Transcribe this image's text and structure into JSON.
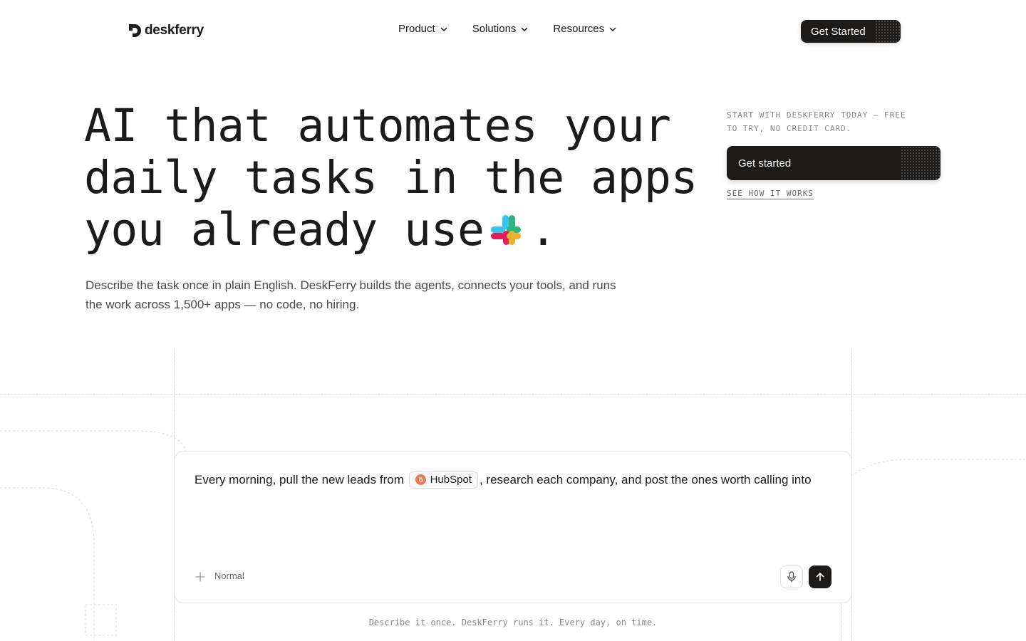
{
  "brand": {
    "name": "deskferry"
  },
  "nav": {
    "items": [
      {
        "label": "Product"
      },
      {
        "label": "Solutions"
      },
      {
        "label": "Resources"
      }
    ],
    "cta_label": "Get Started"
  },
  "hero": {
    "headline_part1": "AI that automates your",
    "headline_highlight": "daily tasks",
    "headline_part2": " in the apps",
    "headline_part3": "you already use",
    "headline_end": ".",
    "inline_icon": "slack-icon",
    "highlight_color": "#c2fa73",
    "subhead": "Describe the task once in plain English. DeskFerry builds the agents, connects your tools, and runs the work across 1,500+ apps — no code, no hiring."
  },
  "cta": {
    "note": "START WITH DESKFERRY TODAY — FREE TO TRY, NO CREDIT CARD.",
    "button_label": "Get started",
    "link_label": "SEE HOW IT WORKS"
  },
  "prompt": {
    "text_before": "Every morning, pull the new leads from",
    "chip_label": "HubSpot",
    "chip_icon": "hubspot-icon",
    "text_after": ", research each company, and post the ones worth calling into",
    "mode_label": "Normal",
    "footnote": "Describe it once. DeskFerry runs it. Every day, on time."
  },
  "colors": {
    "dark": "#1c1b1a",
    "hubspot": "#ef7754"
  }
}
